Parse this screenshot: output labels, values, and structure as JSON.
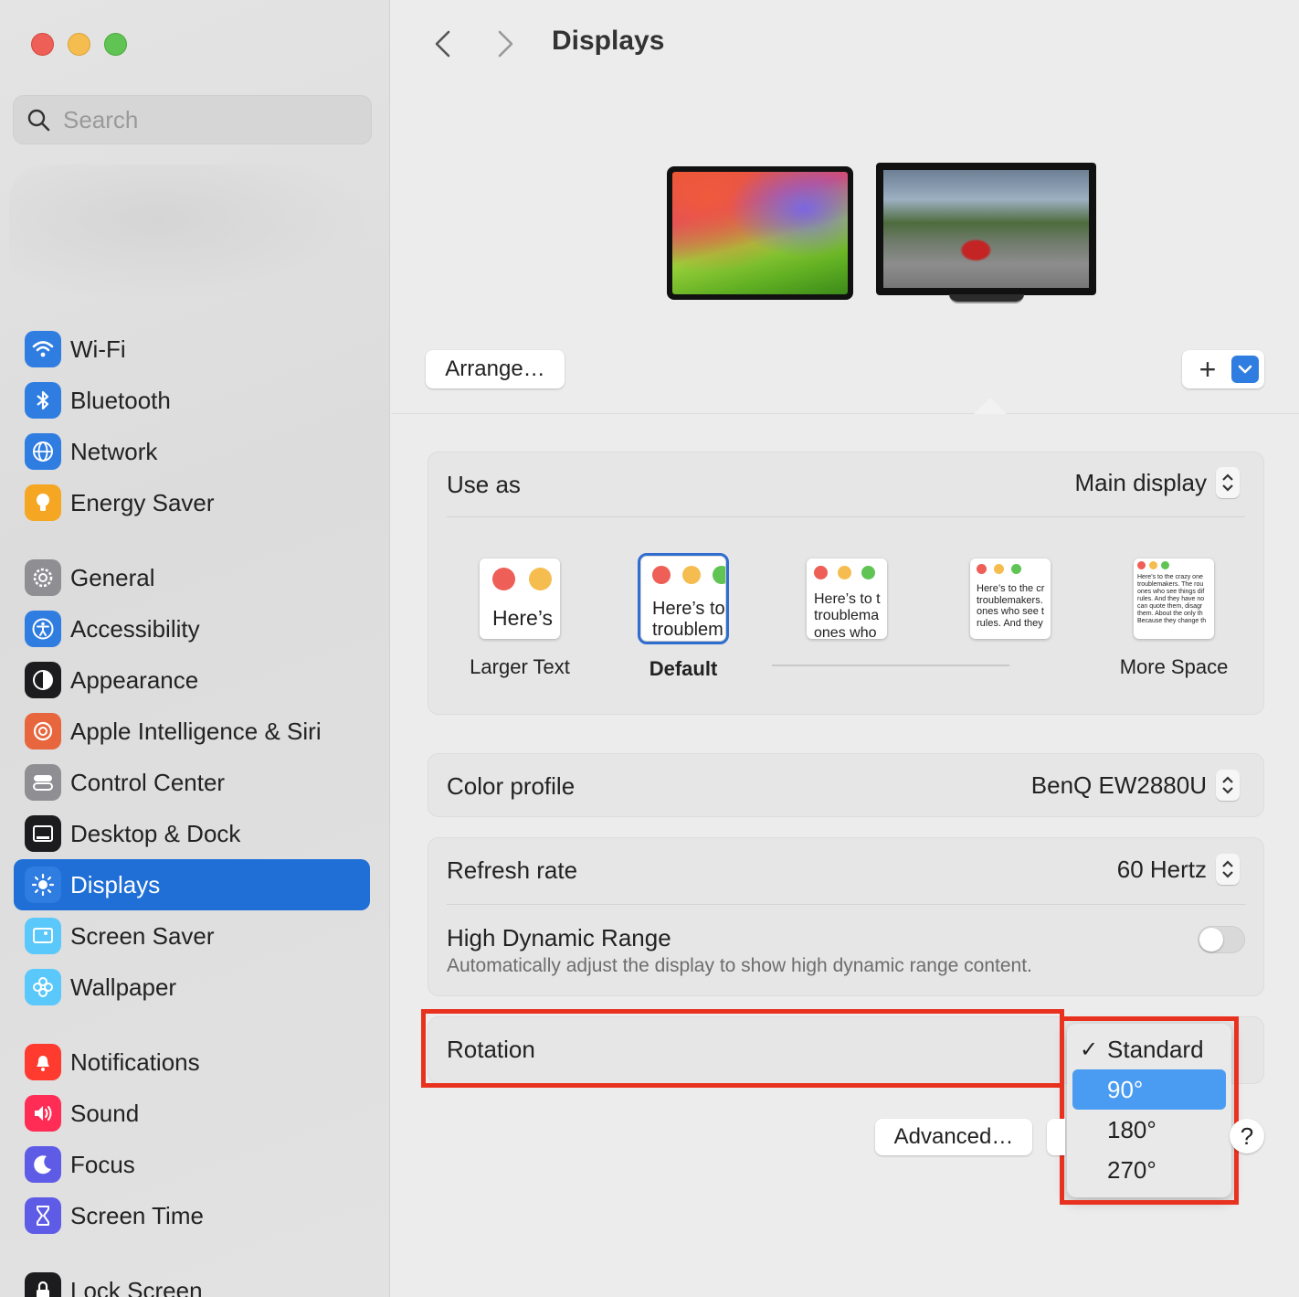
{
  "window": {
    "title": "Displays",
    "traffic_lights": [
      "close",
      "minimize",
      "zoom"
    ]
  },
  "sidebar": {
    "search_placeholder": "Search",
    "items": [
      {
        "label": "Wi-Fi",
        "icon": "wifi-icon",
        "color": "#2f7de1"
      },
      {
        "label": "Bluetooth",
        "icon": "bluetooth-icon",
        "color": "#2f7de1"
      },
      {
        "label": "Network",
        "icon": "globe-icon",
        "color": "#2f7de1"
      },
      {
        "label": "Energy Saver",
        "icon": "lightbulb-icon",
        "color": "#f5a623"
      },
      {
        "label": "General",
        "icon": "gear-icon",
        "color": "#8e8e93"
      },
      {
        "label": "Accessibility",
        "icon": "accessibility-icon",
        "color": "#2f7de1"
      },
      {
        "label": "Appearance",
        "icon": "appearance-icon",
        "color": "#1c1c1e"
      },
      {
        "label": "Apple Intelligence & Siri",
        "icon": "siri-icon",
        "color": "#e8663d"
      },
      {
        "label": "Control Center",
        "icon": "control-center-icon",
        "color": "#8e8e93"
      },
      {
        "label": "Desktop & Dock",
        "icon": "dock-icon",
        "color": "#1c1c1e"
      },
      {
        "label": "Displays",
        "icon": "sun-icon",
        "color": "#2f7de1",
        "selected": true
      },
      {
        "label": "Screen Saver",
        "icon": "screen-saver-icon",
        "color": "#5ac8fa"
      },
      {
        "label": "Wallpaper",
        "icon": "flower-icon",
        "color": "#5ac8fa"
      },
      {
        "label": "Notifications",
        "icon": "bell-icon",
        "color": "#ff3b30"
      },
      {
        "label": "Sound",
        "icon": "speaker-icon",
        "color": "#ff2d55"
      },
      {
        "label": "Focus",
        "icon": "moon-icon",
        "color": "#5e5ce6"
      },
      {
        "label": "Screen Time",
        "icon": "hourglass-icon",
        "color": "#5e5ce6"
      },
      {
        "label": "Lock Screen",
        "icon": "lock-icon",
        "color": "#1c1c1e"
      }
    ]
  },
  "header": {
    "title": "Displays"
  },
  "arrangement": {
    "arrange_label": "Arrange…",
    "add_label": "+"
  },
  "use_as": {
    "label": "Use as",
    "value": "Main display"
  },
  "resolution": {
    "options": [
      {
        "label": "Larger Text",
        "sample": "Here’s",
        "selected": false
      },
      {
        "label": "Default",
        "sample": "Here’s to\ntroublem",
        "selected": true
      },
      {
        "label": "",
        "sample": "Here’s to t\ntroublema\nones who",
        "selected": false
      },
      {
        "label": "",
        "sample": "Here’s to the cr\ntroublemakers.\nones who see t\nrules. And they",
        "selected": false
      },
      {
        "label": "More Space",
        "sample": "Here’s to the crazy one\ntroublemakers. The rou\nones who see things dif\nrules. And they have no\ncan quote them, disagr\nthem. About the only th\nBecause they change th",
        "selected": false
      }
    ]
  },
  "color_profile": {
    "label": "Color profile",
    "value": "BenQ EW2880U"
  },
  "refresh_rate": {
    "label": "Refresh rate",
    "value": "60 Hertz"
  },
  "hdr": {
    "label": "High Dynamic Range",
    "description": "Automatically adjust the display to show high dynamic range content.",
    "enabled": false
  },
  "rotation": {
    "label": "Rotation",
    "options": [
      {
        "label": "Standard",
        "checked": true,
        "highlighted": false
      },
      {
        "label": "90°",
        "checked": false,
        "highlighted": true
      },
      {
        "label": "180°",
        "checked": false,
        "highlighted": false
      },
      {
        "label": "270°",
        "checked": false,
        "highlighted": false
      }
    ],
    "checkmark": "✓"
  },
  "footer": {
    "advanced_label": "Advanced…",
    "help_label": "?"
  },
  "colors": {
    "accent": "#1f6fd6",
    "highlight_annotation": "#e8321f",
    "menu_highlight": "#4a9cf2"
  }
}
